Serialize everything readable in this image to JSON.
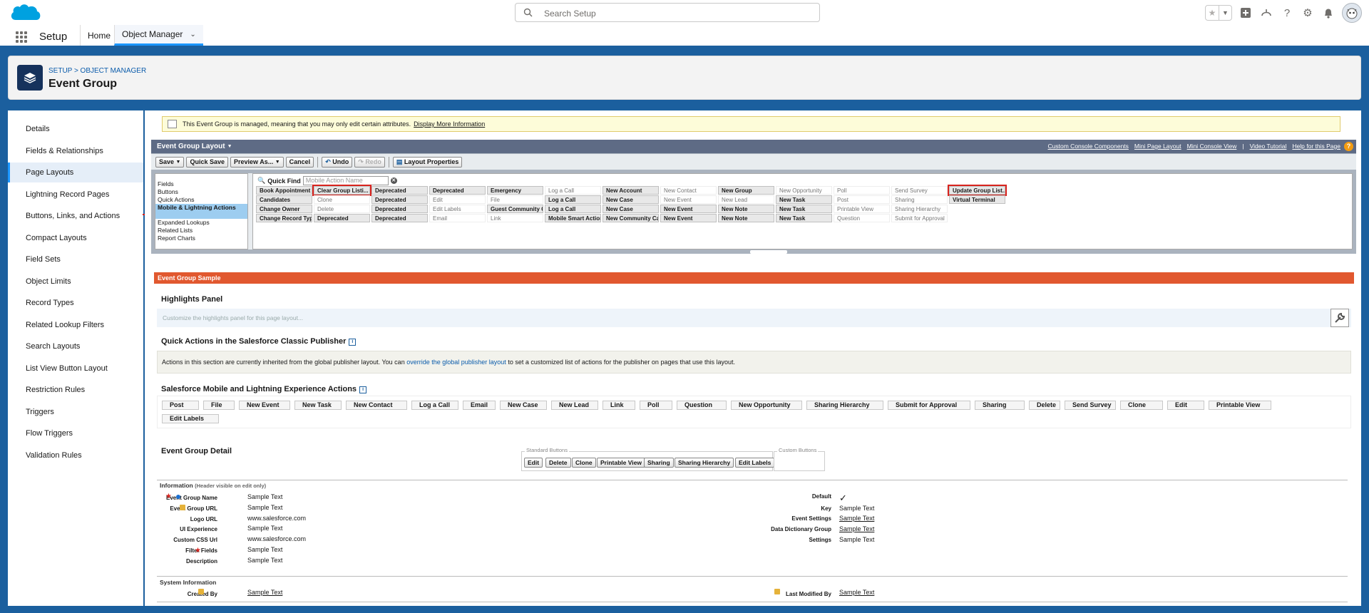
{
  "topbar": {
    "search_placeholder": "Search Setup"
  },
  "nav": {
    "app_name": "Setup",
    "tabs": [
      {
        "label": "Home"
      },
      {
        "label": "Object Manager"
      }
    ]
  },
  "header": {
    "breadcrumb": "SETUP > OBJECT MANAGER",
    "title": "Event Group"
  },
  "sidebar": {
    "items": [
      {
        "label": "Details"
      },
      {
        "label": "Fields & Relationships"
      },
      {
        "label": "Page Layouts"
      },
      {
        "label": "Lightning Record Pages"
      },
      {
        "label": "Buttons, Links, and Actions"
      },
      {
        "label": "Compact Layouts"
      },
      {
        "label": "Field Sets"
      },
      {
        "label": "Object Limits"
      },
      {
        "label": "Record Types"
      },
      {
        "label": "Related Lookup Filters"
      },
      {
        "label": "Search Layouts"
      },
      {
        "label": "List View Button Layout"
      },
      {
        "label": "Restriction Rules"
      },
      {
        "label": "Triggers"
      },
      {
        "label": "Flow Triggers"
      },
      {
        "label": "Validation Rules"
      }
    ],
    "selected": "Page Layouts"
  },
  "notice": {
    "text": "This Event Group is managed, meaning that you may only edit certain attributes.",
    "link": "Display More Information"
  },
  "palette": {
    "title": "Event Group Layout",
    "links": [
      "Custom Console Components",
      "Mini Page Layout",
      "Mini Console View",
      "|",
      "Video Tutorial",
      "Help for this Page"
    ],
    "toolbar": [
      "Save",
      "Quick Save",
      "Preview As...",
      "Cancel",
      "Undo",
      "Redo",
      "Layout Properties"
    ],
    "categories": [
      "Fields",
      "Buttons",
      "Quick Actions",
      "Mobile & Lightning Actions",
      "Expanded Lookups",
      "Related Lists",
      "Report Charts"
    ],
    "selected_category": "Mobile & Lightning Actions",
    "quick_find_label": "Quick Find",
    "quick_find_placeholder": "Mobile Action Name",
    "items": [
      [
        "Book Appointment",
        "Candidates",
        "Change Owner",
        "Change Record Type"
      ],
      [
        "Clear Group Listi...",
        "Clone",
        "Delete",
        "Deprecated"
      ],
      [
        "Deprecated",
        "Deprecated",
        "Deprecated",
        "Deprecated"
      ],
      [
        "Deprecated",
        "Edit",
        "Edit Labels",
        "Email"
      ],
      [
        "Emergency",
        "File",
        "Guest Community Case",
        "Link"
      ],
      [
        "Log a Call",
        "Log a Call",
        "Log a Call",
        "Mobile Smart Actions"
      ],
      [
        "New Account",
        "New Case",
        "New Case",
        "New Community Case"
      ],
      [
        "New Contact",
        "New Event",
        "New Event",
        "New Event"
      ],
      [
        "New Group",
        "New Lead",
        "New Note",
        "New Note"
      ],
      [
        "New Opportunity",
        "New Task",
        "New Task",
        "New Task"
      ],
      [
        "Poll",
        "Post",
        "Printable View",
        "Question"
      ],
      [
        "Send Survey",
        "Sharing",
        "Sharing Hierarchy",
        "Submit for Approval"
      ],
      [
        "Update Group List...",
        "Virtual Terminal"
      ]
    ]
  },
  "layout": {
    "banner": "Event Group Sample",
    "highlights_title": "Highlights Panel",
    "highlights_placeholder": "Customize the highlights panel for this page layout...",
    "classic_title": "Quick Actions in the Salesforce Classic Publisher",
    "classic_text_1": "Actions in this section are currently inherited from the global publisher layout. You can",
    "classic_link": "override the global publisher layout",
    "classic_text_2": "to set a customized list of actions for the publisher on pages that use this layout.",
    "mobile_title": "Salesforce Mobile and Lightning Experience Actions",
    "mobile_actions": [
      "Post",
      "File",
      "New Event",
      "New Task",
      "New Contact",
      "Log a Call",
      "Email",
      "New Case",
      "New Lead",
      "Link",
      "Poll",
      "Question",
      "New Opportunity",
      "Sharing Hierarchy",
      "Submit for Approval",
      "Sharing",
      "Delete",
      "Send Survey",
      "Clone",
      "Edit",
      "Printable View",
      "Edit Labels"
    ],
    "detail_title": "Event Group Detail",
    "standard_buttons_label": "Standard Buttons",
    "standard_buttons": [
      "Edit",
      "Delete",
      "Clone",
      "Printable View",
      "Sharing",
      "Sharing Hierarchy",
      "Edit Labels"
    ],
    "custom_buttons_label": "Custom Buttons",
    "info_section": "Information",
    "info_section_note": "(Header visible on edit only)",
    "left_fields": [
      {
        "label": "Event Group Name",
        "value": "Sample Text"
      },
      {
        "label": "Event Group URL",
        "value": "Sample Text"
      },
      {
        "label": "Logo URL",
        "value": "www.salesforce.com"
      },
      {
        "label": "UI Experience",
        "value": "Sample Text"
      },
      {
        "label": "Custom CSS Url",
        "value": "www.salesforce.com"
      },
      {
        "label": "Filter Fields",
        "value": "Sample Text"
      },
      {
        "label": "Description",
        "value": "Sample Text"
      }
    ],
    "right_fields": [
      {
        "label": "Default",
        "value": "✓"
      },
      {
        "label": "Key",
        "value": "Sample Text"
      },
      {
        "label": "Event Settings",
        "value": "Sample Text"
      },
      {
        "label": "Data Dictionary Group",
        "value": "Sample Text"
      },
      {
        "label": "Settings",
        "value": "Sample Text"
      }
    ],
    "system_section": "System Information",
    "system_fields": [
      {
        "label": "Created By",
        "value": "Sample Text"
      },
      {
        "label": "Last Modified By",
        "value": "Sample Text"
      }
    ]
  },
  "colors": {
    "brand": "#1b5f9e",
    "accent": "#1b96ff",
    "banner": "#e1582f",
    "highlight": "#d9231e"
  }
}
